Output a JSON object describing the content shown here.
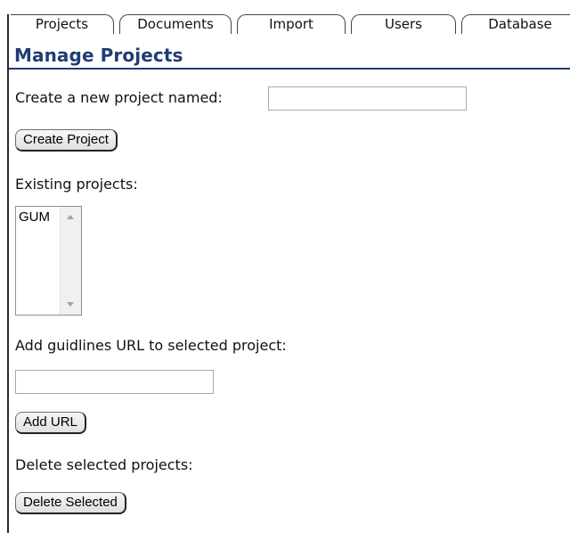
{
  "tabs": [
    {
      "label": "Projects",
      "active": true
    },
    {
      "label": "Documents",
      "active": false
    },
    {
      "label": "Import",
      "active": false
    },
    {
      "label": "Users",
      "active": false
    },
    {
      "label": "Database",
      "active": false
    }
  ],
  "main": {
    "title": "Manage Projects",
    "create_label": "Create a new project named:",
    "create_input_value": "",
    "create_button": "Create Project",
    "existing_label": "Existing projects:",
    "projects": [
      "GUM"
    ],
    "url_label": "Add guidlines URL to selected project:",
    "url_input_value": "",
    "add_url_button": "Add URL",
    "delete_label": "Delete selected projects:",
    "delete_button": "Delete Selected"
  },
  "colors": {
    "title": "#1f3d73",
    "rule": "#1f3d73"
  }
}
